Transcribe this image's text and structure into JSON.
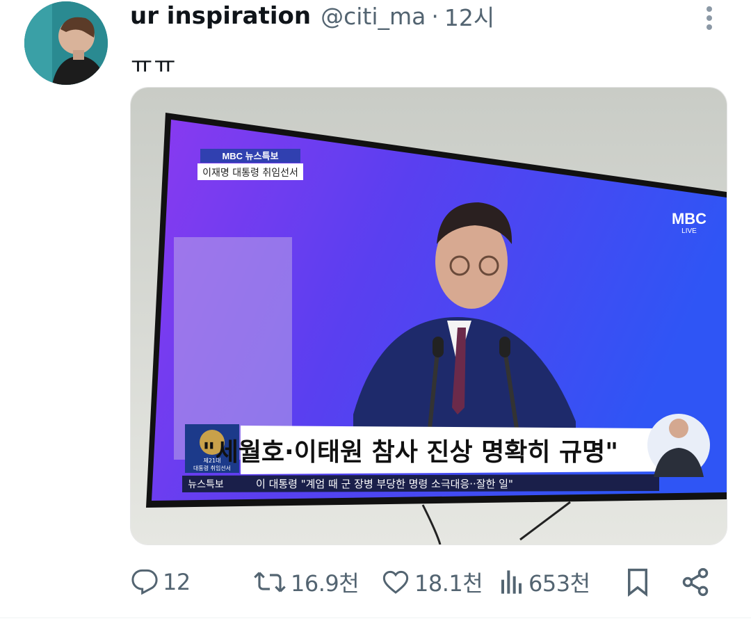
{
  "tweet": {
    "display_name": "ur inspiration",
    "handle": "@citi_ma",
    "separator": "·",
    "time": "12시",
    "text": "ㅠㅠ"
  },
  "media": {
    "tv": {
      "badge_program": "MBC 뉴스특보",
      "badge_subtitle": "이재명 대통령 취임선서",
      "channel_logo": "MBC",
      "channel_live": "LIVE",
      "headline": "\"세월호·이태원 참사 진상 명확히 규명\"",
      "ticker_label": "뉴스특보",
      "ticker_text": "이 대통령 \"계엄 때 군 장병 부당한 명령 소극대응··잘한 일\"",
      "seal_caption_1": "제21대",
      "seal_caption_2": "대통령 취임선서"
    }
  },
  "actions": {
    "reply_count": "12",
    "retweet_count": "16.9천",
    "like_count": "18.1천",
    "view_count": "653천"
  },
  "icons": {
    "more": "more-vertical-icon",
    "reply": "reply-icon",
    "retweet": "retweet-icon",
    "like": "heart-icon",
    "views": "views-icon",
    "bookmark": "bookmark-icon",
    "share": "share-icon"
  },
  "colors": {
    "text": "#0f1419",
    "muted": "#536471",
    "tv_purple": "#7a3cf0",
    "tv_blue": "#3b4cf5"
  }
}
